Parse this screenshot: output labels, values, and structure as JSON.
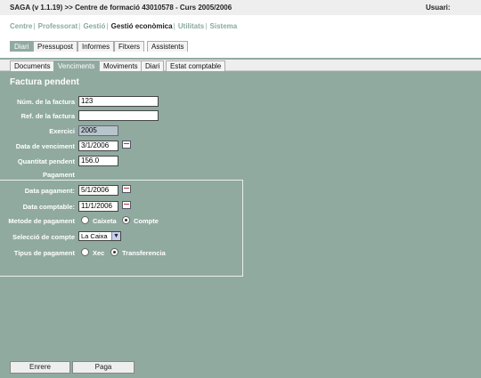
{
  "window": {
    "title": "SAGA (v 1.1.19) >> Centre de formació 43010578 - Curs 2005/2006",
    "user_label": "Usuari:"
  },
  "nav": {
    "items": [
      "Centre",
      "Professorat",
      "Gestió",
      "Gestió econòmica",
      "Utilitats",
      "Sistema"
    ],
    "separator": "|",
    "active": "Gestió econòmica"
  },
  "tabs_main": [
    "Diari",
    "Pressupost",
    "Informes",
    "Fitxers",
    "Assistents"
  ],
  "tabs_main_active": "Diari",
  "tabs_sub": [
    "Documents",
    "Venciments",
    "Moviments",
    "Diari",
    "Estat comptable"
  ],
  "tabs_sub_active": "Venciments",
  "form": {
    "title": "Factura pendent",
    "fields": {
      "num_factura": {
        "label": "Núm. de la factura",
        "value": "123"
      },
      "ref_factura": {
        "label": "Ref. de la factura",
        "value": ""
      },
      "exercici": {
        "label": "Exercici",
        "value": "2005"
      },
      "data_venciment": {
        "label": "Data de venciment",
        "value": "3/1/2006"
      },
      "quantitat_pendent": {
        "label": "Quantitat pendent",
        "value": "156.0"
      }
    }
  },
  "pagament": {
    "section_label": "Pagament",
    "data_pagament": {
      "label": "Data pagament:",
      "value": "5/1/2006"
    },
    "data_comptable": {
      "label": "Data comptable:",
      "value": "11/1/2006"
    },
    "metode": {
      "label": "Metode de pagament",
      "options": [
        "Caixeta",
        "Compte"
      ],
      "selected": "Compte"
    },
    "compte": {
      "label": "Selecció de compte",
      "value": "La Caixa"
    },
    "tipus": {
      "label": "Tipus de pagament",
      "options": [
        "Xec",
        "Transferencia"
      ],
      "selected": "Transferencia"
    }
  },
  "buttons": {
    "back": "Enrere",
    "pay": "Paga"
  }
}
